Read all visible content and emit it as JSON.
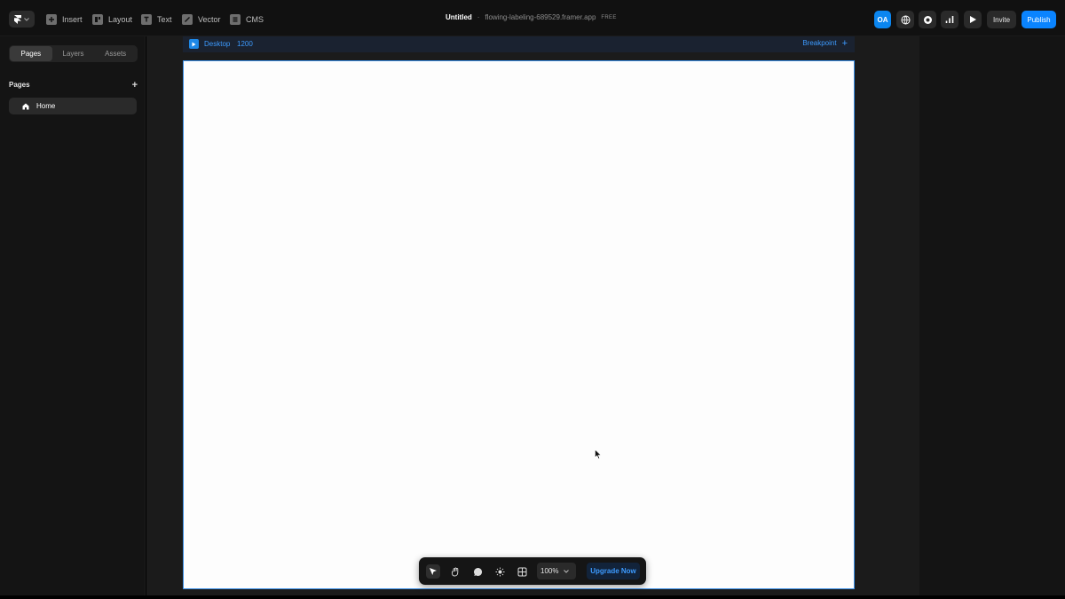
{
  "topbar": {
    "tools": [
      {
        "label": "Insert",
        "icon": "plus-square-icon"
      },
      {
        "label": "Layout",
        "icon": "layout-icon"
      },
      {
        "label": "Text",
        "icon": "text-icon"
      },
      {
        "label": "Vector",
        "icon": "pen-icon"
      },
      {
        "label": "CMS",
        "icon": "database-icon"
      }
    ],
    "title": "Untitled",
    "separator": "·",
    "url": "flowing-labeling-689529.framer.app",
    "plan_badge": "FREE",
    "avatar_initials": "OA",
    "invite_label": "Invite",
    "publish_label": "Publish"
  },
  "left_panel": {
    "tabs": [
      "Pages",
      "Layers",
      "Assets"
    ],
    "active_tab": "Pages",
    "section_title": "Pages",
    "add_symbol": "+",
    "pages": [
      {
        "label": "Home",
        "icon": "home-icon"
      }
    ]
  },
  "canvas": {
    "frame_name": "Desktop",
    "frame_width": "1200",
    "breakpoint_label": "Breakpoint",
    "breakpoint_add": "+"
  },
  "bottom_toolbar": {
    "tools": [
      "select-arrow-icon",
      "hand-icon",
      "comment-icon",
      "sun-icon",
      "grid-icon"
    ],
    "zoom_value": "100%",
    "upgrade_label": "Upgrade Now"
  },
  "colors": {
    "accent": "#0a84ff",
    "background": "#000000",
    "panel": "#141414",
    "artboard": "#fdfdfd"
  }
}
